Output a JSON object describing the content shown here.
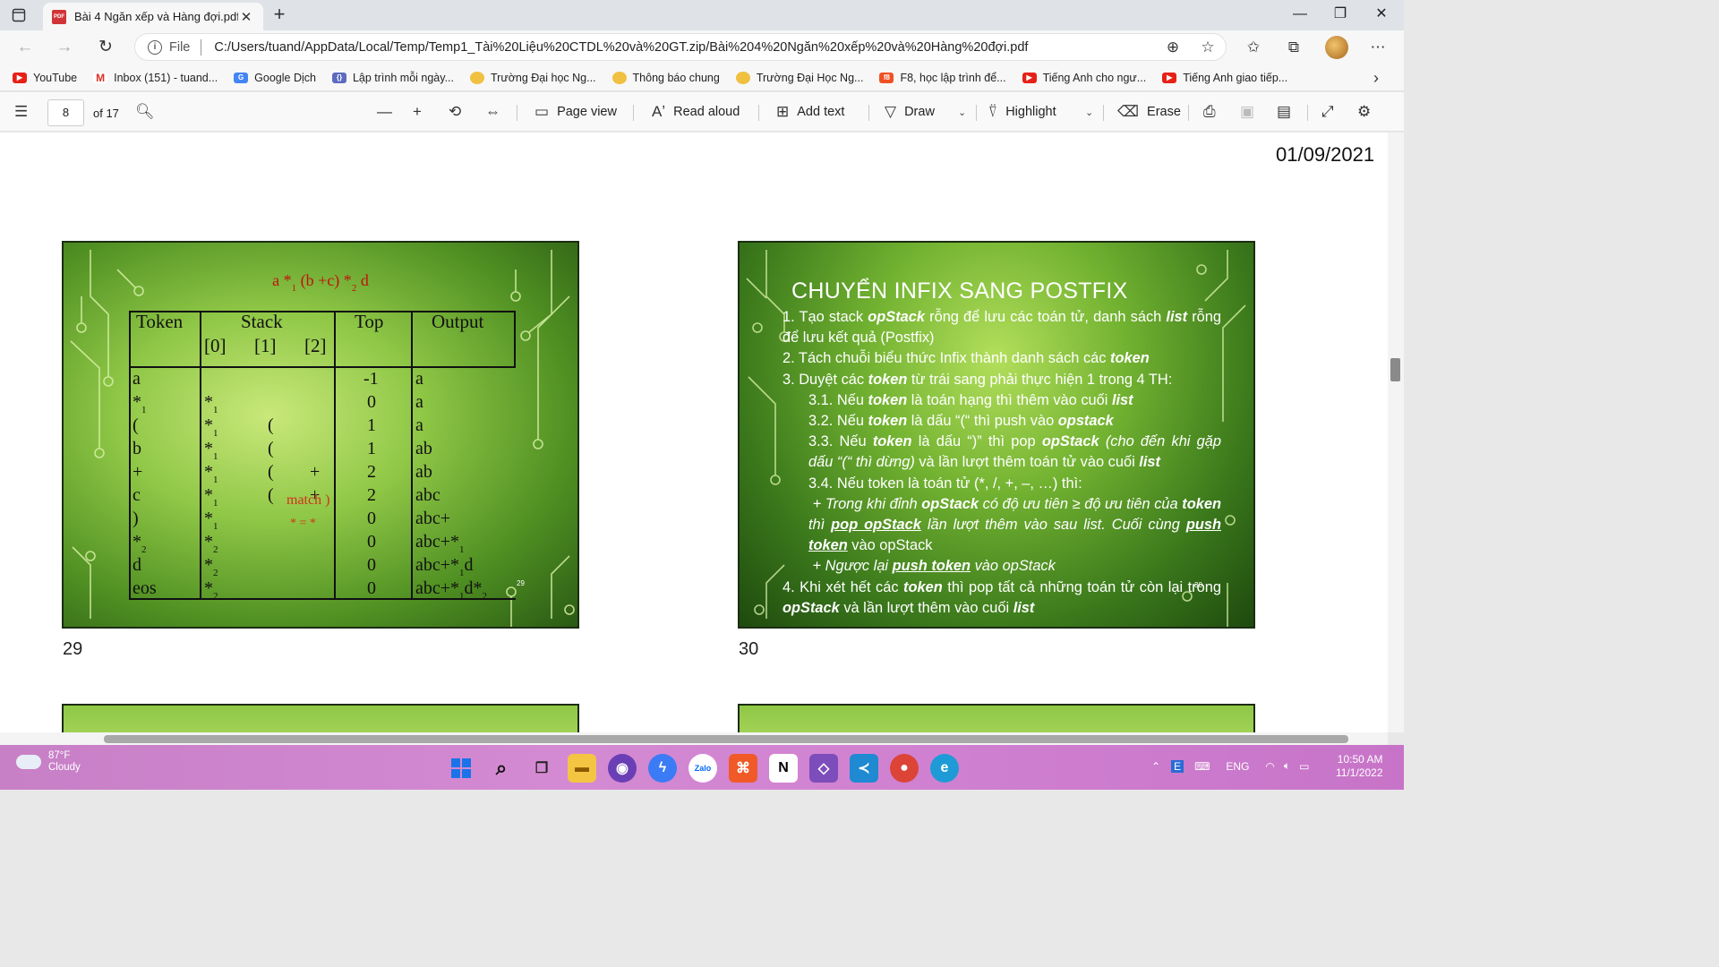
{
  "browser": {
    "tab_title": "Bài 4 Ngăn xếp và Hàng đợi.pdf",
    "file_label": "File",
    "url": "C:/Users/tuand/AppData/Local/Temp/Temp1_Tài%20Liệu%20CTDL%20và%20GT.zip/Bài%204%20Ngăn%20xếp%20và%20Hàng%20đợi.pdf"
  },
  "favorites": [
    {
      "label": "YouTube",
      "icon": "youtube-icon"
    },
    {
      "label": "Inbox (151) - tuand...",
      "icon": "gmail-icon"
    },
    {
      "label": "Google Dịch",
      "icon": "google-translate-icon"
    },
    {
      "label": "Lập trình mỗi ngày...",
      "icon": "code-icon"
    },
    {
      "label": "Trường Đại học Ng...",
      "icon": "university-icon"
    },
    {
      "label": "Thông báo chung",
      "icon": "university-icon"
    },
    {
      "label": "Trường Đại Học Ng...",
      "icon": "university-icon"
    },
    {
      "label": "F8, học lập trình để...",
      "icon": "f8-icon"
    },
    {
      "label": "Tiếng Anh cho ngư...",
      "icon": "youtube-icon"
    },
    {
      "label": "Tiếng Anh giao tiếp...",
      "icon": "youtube-icon"
    }
  ],
  "pdf_toolbar": {
    "page_number": "8",
    "page_total": "of 17",
    "page_view": "Page view",
    "read_aloud": "Read aloud",
    "add_text": "Add text",
    "draw": "Draw",
    "highlight": "Highlight",
    "erase": "Erase"
  },
  "document": {
    "date": "01/09/2021",
    "slide_numbers": [
      "29",
      "30"
    ]
  },
  "slide29": {
    "formula_parts": [
      "a *",
      "1",
      " (b +c) *",
      "2",
      " d"
    ],
    "headers": {
      "token": "Token",
      "stack": "Stack",
      "top": "Top",
      "output": "Output",
      "s0": "[0]",
      "s1": "[1]",
      "s2": "[2]"
    },
    "rows": [
      {
        "token": "a",
        "top": "-1",
        "output": "a"
      },
      {
        "token": "*",
        "top": "0",
        "output": "a"
      },
      {
        "token": "(",
        "top": "1",
        "output": "a"
      },
      {
        "token": "b",
        "top": "1",
        "output": "ab"
      },
      {
        "token": "+",
        "top": "2",
        "output": "ab"
      },
      {
        "token": "c",
        "top": "2",
        "output": "abc"
      },
      {
        "token": ")",
        "top": "0",
        "output": "abc+"
      },
      {
        "token": "*",
        "top": "0",
        "output": "abc+*"
      },
      {
        "token": "d",
        "top": "0",
        "output": "abc+*"
      },
      {
        "token": "eos",
        "top": "0",
        "output": "abc+*"
      }
    ],
    "annotation_match": "match )",
    "annotation_eq": "* = *",
    "page_no": "29"
  },
  "slide30": {
    "title": "CHUYỂN INFIX SANG POSTFIX",
    "page_no": "30"
  },
  "taskbar": {
    "temp": "87°F",
    "weather": "Cloudy",
    "lang": "ENG",
    "time": "10:50 AM",
    "date": "11/1/2022"
  }
}
